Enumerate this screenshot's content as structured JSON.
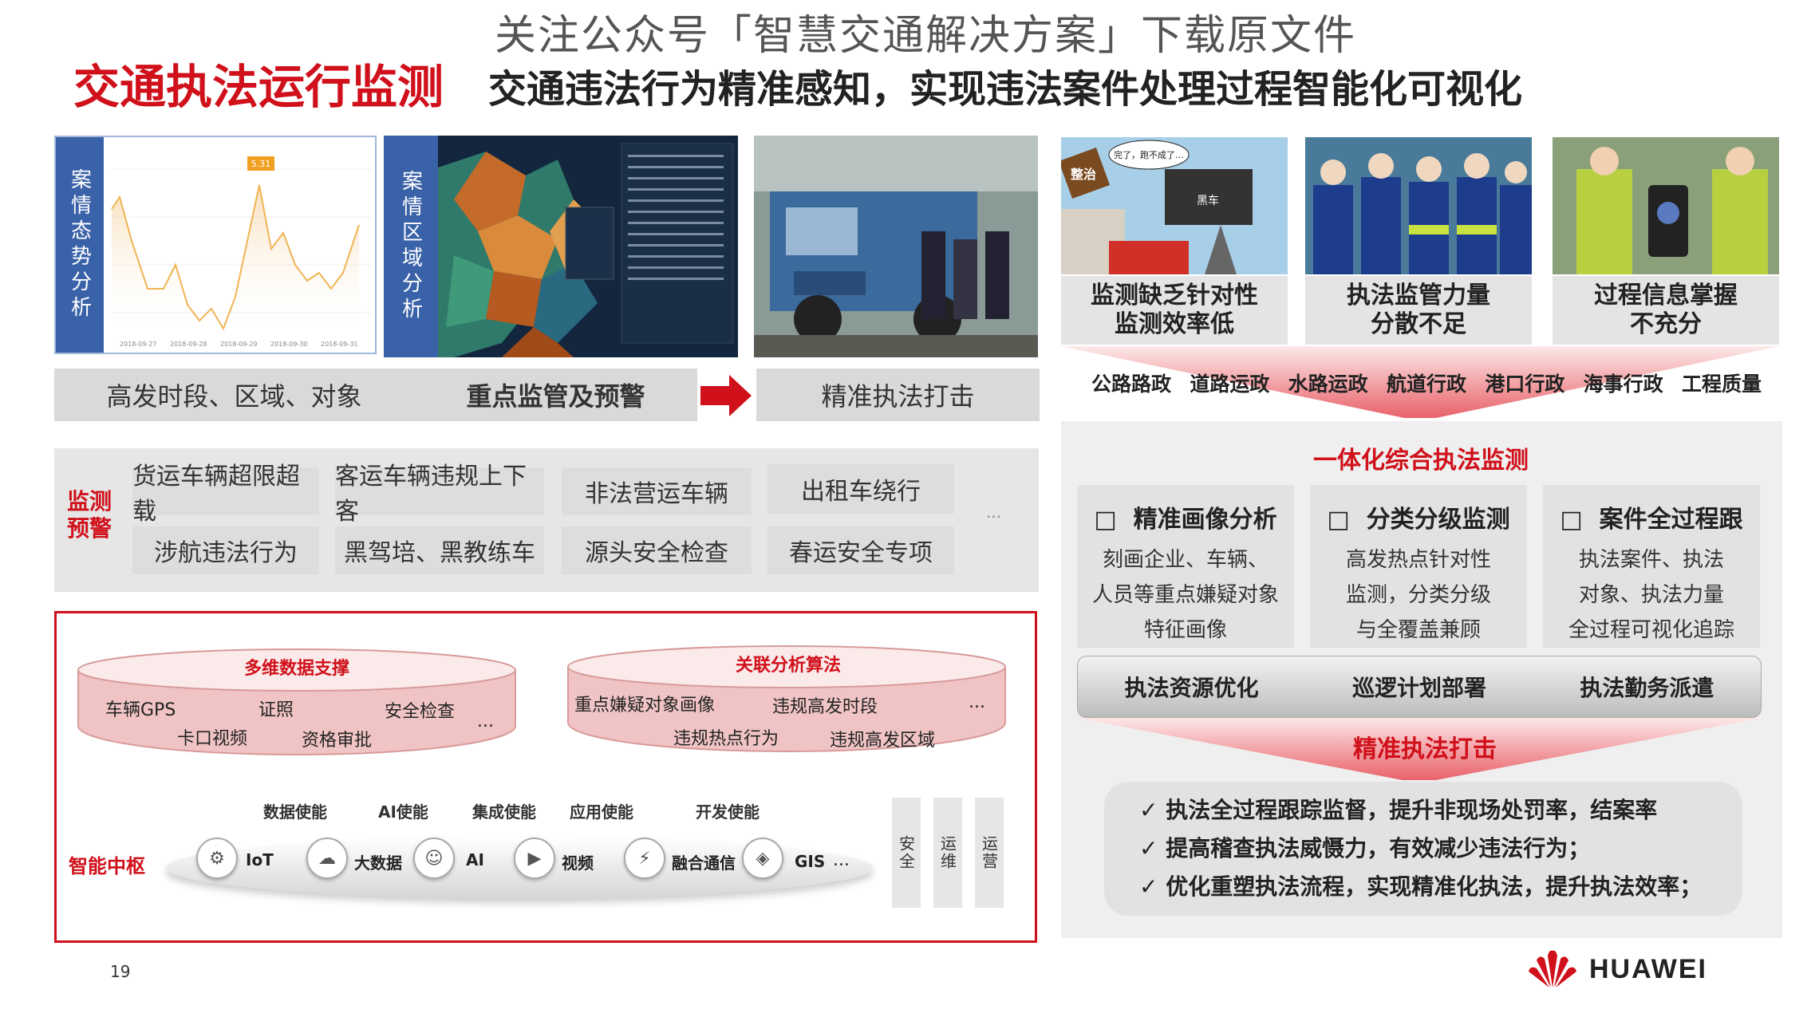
{
  "watermark": "关注公众号「智慧交通解决方案」下载原文件",
  "title": "交通执法运行监测",
  "subtitle": "交通违法行为精准感知，实现违法案件处理过程智能化可视化",
  "left_top": {
    "chart_label": "案情态势分析",
    "map_label": "案情区域分析",
    "chart_peak": "5.31",
    "chart_dates": [
      "2018-09-27",
      "2018-09-28",
      "2018-09-29",
      "2018-09-30",
      "2018-09-31"
    ]
  },
  "flow": {
    "item1": "高发时段、区域、对象",
    "item2": "重点监管及预警",
    "item3": "精准执法打击"
  },
  "monitor": {
    "label": "监测预警",
    "chips": [
      "货运车辆超限超载",
      "客运车辆违规上下客",
      "非法营运车辆",
      "出租车绕行",
      "涉航违法行为",
      "黑驾培、黑教练车",
      "源头安全检查",
      "春运安全专项"
    ],
    "more": "..."
  },
  "hub": {
    "cyl1": {
      "title": "多维数据支撑",
      "items": [
        "车辆GPS",
        "证照",
        "安全检查",
        "卡口视频",
        "资格审批"
      ],
      "more": "..."
    },
    "cyl2": {
      "title": "关联分析算法",
      "items": [
        "重点嫌疑对象画像",
        "违规高发时段",
        "违规热点行为",
        "违规高发区域"
      ],
      "more": "..."
    },
    "label": "智能中枢",
    "enablers": [
      "数据使能",
      "AI使能",
      "集成使能",
      "应用使能",
      "开发使能"
    ],
    "icons": [
      {
        "name": "iot-icon",
        "label": "IoT",
        "glyph": "⚙"
      },
      {
        "name": "big-data-icon",
        "label": "大数据",
        "glyph": "☁"
      },
      {
        "name": "ai-icon",
        "label": "AI",
        "glyph": "☺"
      },
      {
        "name": "video-icon",
        "label": "视频",
        "glyph": "▶"
      },
      {
        "name": "converged-comm-icon",
        "label": "融合通信",
        "glyph": "⚡"
      },
      {
        "name": "gis-icon",
        "label": "GIS",
        "glyph": "◈"
      }
    ],
    "icons_more": "...",
    "side": [
      "安全",
      "运维",
      "运营"
    ]
  },
  "right": {
    "captions": [
      "监测缺乏针对性\n监测效率低",
      "执法监管力量\n分散不足",
      "过程信息掌握\n不充分"
    ],
    "cartoon_bubble": "完了，跑不成了…",
    "cartoon_sign": "整治",
    "cartoon_car": "黑车",
    "domains": [
      "公路路政",
      "道路运政",
      "水路运政",
      "航道行政",
      "港口行政",
      "海事行政",
      "工程质量"
    ],
    "integrated": "一体化综合执法监测",
    "cards": [
      {
        "title": "精准画像分析",
        "lines": [
          "刻画企业、车辆、",
          "人员等重点嫌疑对象",
          "特征画像"
        ]
      },
      {
        "title": "分类分级监测",
        "lines": [
          "高发热点针对性",
          "监测，分类分级",
          "与全覆盖兼顾"
        ]
      },
      {
        "title": "案件全过程跟",
        "lines": [
          "执法案件、执法",
          "对象、执法力量",
          "全过程可视化追踪"
        ]
      }
    ],
    "bar_items": [
      "执法资源优化",
      "巡逻计划部署",
      "执法勤务派遣"
    ],
    "precise": "精准执法打击",
    "checks": [
      "执法全过程跟踪监督，提升非现场处罚率，结案率",
      "提高稽查执法威慑力，有效减少违法行为；",
      "优化重塑执法流程，实现精准化执法，提升执法效率；"
    ]
  },
  "footer": {
    "page": "19",
    "brand": "HUAWEI"
  },
  "colors": {
    "accent": "#d0101a",
    "blue": "#3a62a8"
  }
}
